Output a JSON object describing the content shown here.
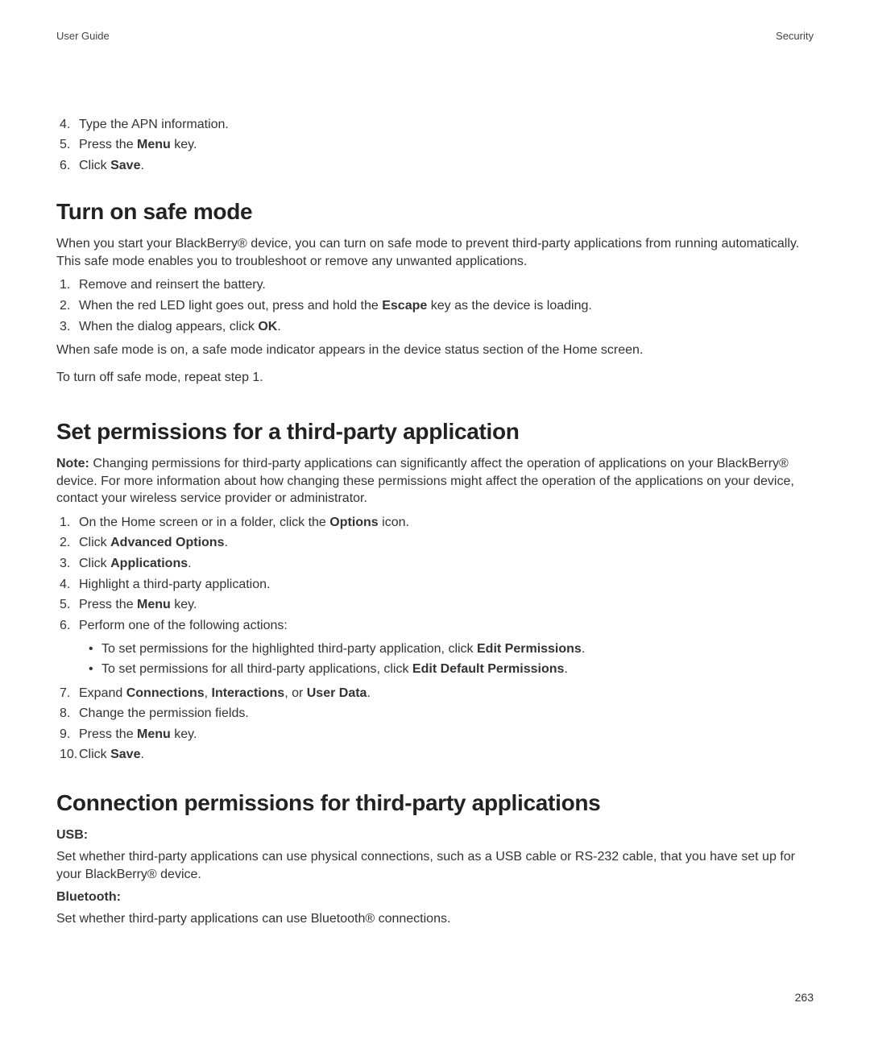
{
  "header": {
    "left": "User Guide",
    "right": "Security"
  },
  "topSteps": [
    {
      "n": "4.",
      "pre": "Type the APN information."
    },
    {
      "n": "5.",
      "pre": "Press the ",
      "b": "Menu",
      "post": " key."
    },
    {
      "n": "6.",
      "pre": "Click ",
      "b": "Save",
      "post": "."
    }
  ],
  "safe": {
    "title": "Turn on safe mode",
    "intro": "When you start your BlackBerry® device, you can turn on safe mode to prevent third-party applications from running automatically. This safe mode enables you to troubleshoot or remove any unwanted applications.",
    "steps": [
      {
        "n": "1.",
        "pre": "Remove and reinsert the battery."
      },
      {
        "n": "2.",
        "pre": "When the red LED light goes out, press and hold the ",
        "b": "Escape",
        "post": " key as the device is loading."
      },
      {
        "n": "3.",
        "pre": "When the dialog appears, click ",
        "b": "OK",
        "post": "."
      }
    ],
    "after1": "When safe mode is on, a safe mode indicator appears in the device status section of the Home screen.",
    "after2": "To turn off safe mode, repeat step 1."
  },
  "perm": {
    "title": "Set permissions for a third-party application",
    "noteLabel": "Note:",
    "noteBody": "  Changing permissions for third-party applications can significantly affect the operation of applications on your BlackBerry® device. For more information about how changing these permissions might affect the operation of the applications on your device, contact your wireless service provider or administrator.",
    "steps": [
      {
        "n": "1.",
        "pre": "On the Home screen or in a folder, click the ",
        "b": "Options",
        "post": " icon."
      },
      {
        "n": "2.",
        "pre": "Click ",
        "b": "Advanced Options",
        "post": "."
      },
      {
        "n": "3.",
        "pre": "Click ",
        "b": "Applications",
        "post": "."
      },
      {
        "n": "4.",
        "pre": "Highlight a third-party application."
      },
      {
        "n": "5.",
        "pre": "Press the ",
        "b": "Menu",
        "post": " key."
      },
      {
        "n": "6.",
        "pre": "Perform one of the following actions:"
      }
    ],
    "bullets": [
      {
        "pre": "To set permissions for the highlighted third-party application, click ",
        "b": "Edit Permissions",
        "post": "."
      },
      {
        "pre": "To set permissions for all third-party applications, click ",
        "b": "Edit Default Permissions",
        "post": "."
      }
    ],
    "steps2": [
      {
        "n": "7.",
        "pre": "Expand ",
        "b": "Connections",
        "mid1": ", ",
        "b2": "Interactions",
        "mid2": ", or ",
        "b3": "User Data",
        "post": "."
      },
      {
        "n": "8.",
        "pre": "Change the permission fields."
      },
      {
        "n": "9.",
        "pre": "Press the ",
        "b": "Menu",
        "post": " key."
      },
      {
        "n": "10.",
        "pre": "Click ",
        "b": "Save",
        "post": "."
      }
    ]
  },
  "conn": {
    "title": "Connection permissions for third-party applications",
    "defs": [
      {
        "label": "USB:",
        "body": "Set whether third-party applications can use physical connections, such as a USB cable or RS-232 cable, that you have set up for your BlackBerry® device."
      },
      {
        "label": "Bluetooth:",
        "body": "Set whether third-party applications can use Bluetooth® connections."
      }
    ]
  },
  "pageNumber": "263"
}
